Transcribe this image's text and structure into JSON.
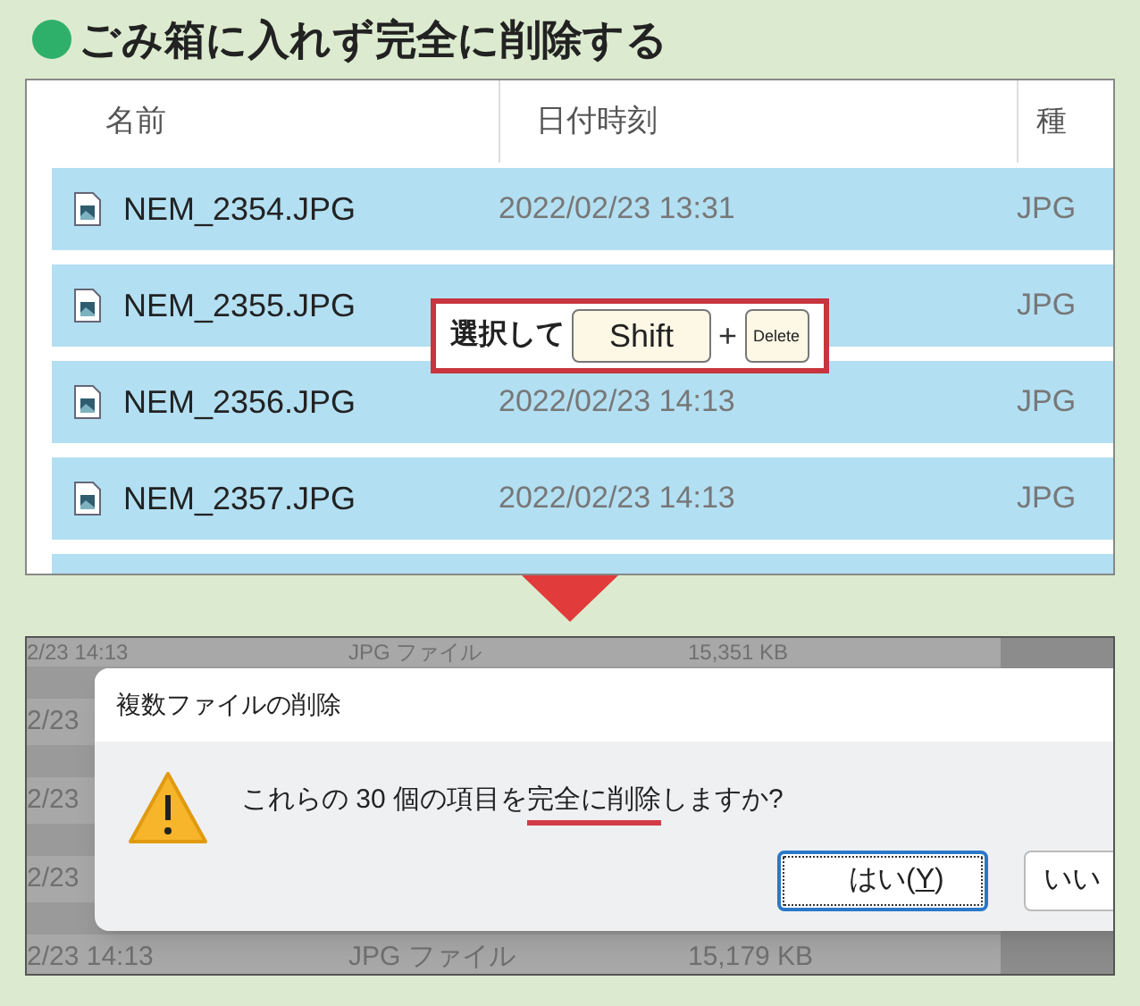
{
  "heading": "ごみ箱に入れず完全に削除する",
  "explorer": {
    "columns": [
      "名前",
      "日付時刻",
      "種"
    ],
    "rows": [
      {
        "name": "NEM_2354.JPG",
        "date": "2022/02/23 13:31",
        "type": "JPG",
        "selected": true
      },
      {
        "name": "NEM_2355.JPG",
        "type": "JPG",
        "selected": true
      },
      {
        "name": "NEM_2356.JPG",
        "date": "2022/02/23 14:13",
        "type": "JPG",
        "selected": true
      },
      {
        "name": "NEM_2357.JPG",
        "date": "2022/02/23 14:13",
        "type": "JPG",
        "selected": true
      }
    ]
  },
  "callout": {
    "text": "選択して",
    "keys": [
      "Shift",
      "Delete"
    ],
    "plus": "+"
  },
  "background_rows": [
    {
      "date": "2/23 14:13",
      "type": "JPG ファイル",
      "size": "15,351 KB"
    },
    {
      "date": "2/23"
    },
    {
      "date": "2/23"
    },
    {
      "date": "2/23"
    },
    {
      "date": "2/23 14:13",
      "type": "JPG ファイル",
      "size": "15,179 KB"
    }
  ],
  "dialog": {
    "title": "複数ファイルの削除",
    "message": {
      "before": "これらの 30 個の項目を",
      "emphasis": "完全に削除",
      "after": "しますか?"
    },
    "buttons": [
      {
        "label_before": "はい(",
        "access_key": "Y",
        "label_after": ")",
        "focused": true
      },
      {
        "label_before": "いい",
        "focused": false
      }
    ]
  }
}
